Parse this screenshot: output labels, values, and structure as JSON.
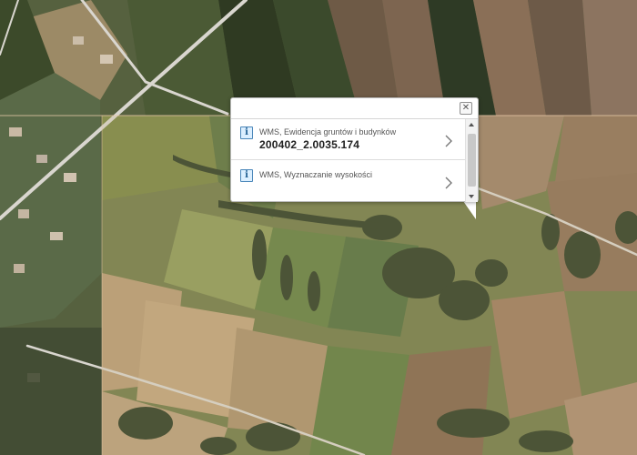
{
  "map": {
    "layers": [
      "orthophoto",
      "parcel-boundaries"
    ],
    "colors": {
      "field_dark": "#3d4a2a",
      "field_green": "#5d7a3a",
      "field_tan": "#a08462",
      "field_brown": "#7a5f48",
      "wms_tint": "#c8b08a",
      "road": "#d9d6cf",
      "boundary_line": "#e8c8a8"
    }
  },
  "popup": {
    "close_icon": "close-icon",
    "results": [
      {
        "icon": "info-icon",
        "icon_glyph": "i",
        "title": "WMS, Ewidencja gruntów i budynków",
        "value": "200402_2.0035.174"
      },
      {
        "icon": "info-icon",
        "icon_glyph": "i",
        "title": "WMS, Wyznaczanie wysokości",
        "value": ""
      }
    ]
  }
}
